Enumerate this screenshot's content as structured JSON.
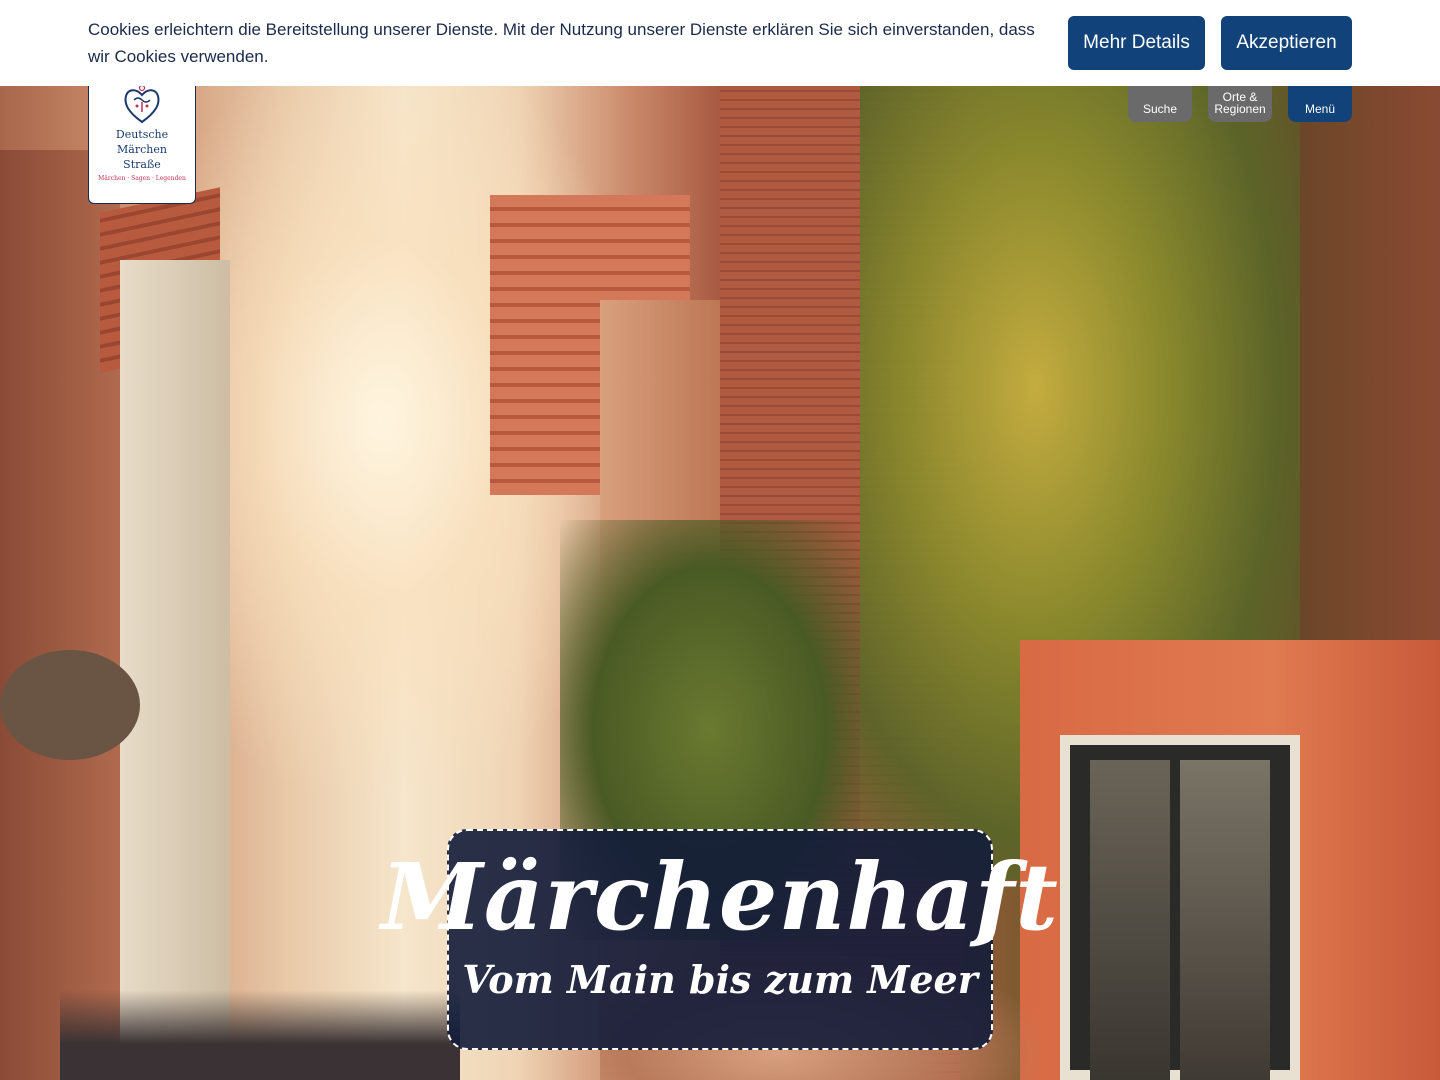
{
  "cookie_banner": {
    "text": "Cookies erleichtern die Bereitstellung unserer Dienste. Mit der Nutzung unserer Dienste erklären Sie sich einverstanden, dass wir Cookies verwenden.",
    "details_label": "Mehr Details",
    "accept_label": "Akzeptieren"
  },
  "logo": {
    "title_line1": "Deutsche",
    "title_line2": "Märchen",
    "title_line3": "Straße",
    "tagline": "Märchen · Sagen · Legenden"
  },
  "nav": {
    "search_label": "Suche",
    "places_label": "Orte & Regionen",
    "menu_label": "Menü"
  },
  "hero": {
    "title": "Märchenhaft",
    "subtitle": "Vom Main bis zum Meer"
  },
  "colors": {
    "primary": "#11427a",
    "nav_gray": "#6a6a6a",
    "logo_accent": "#c03050"
  }
}
